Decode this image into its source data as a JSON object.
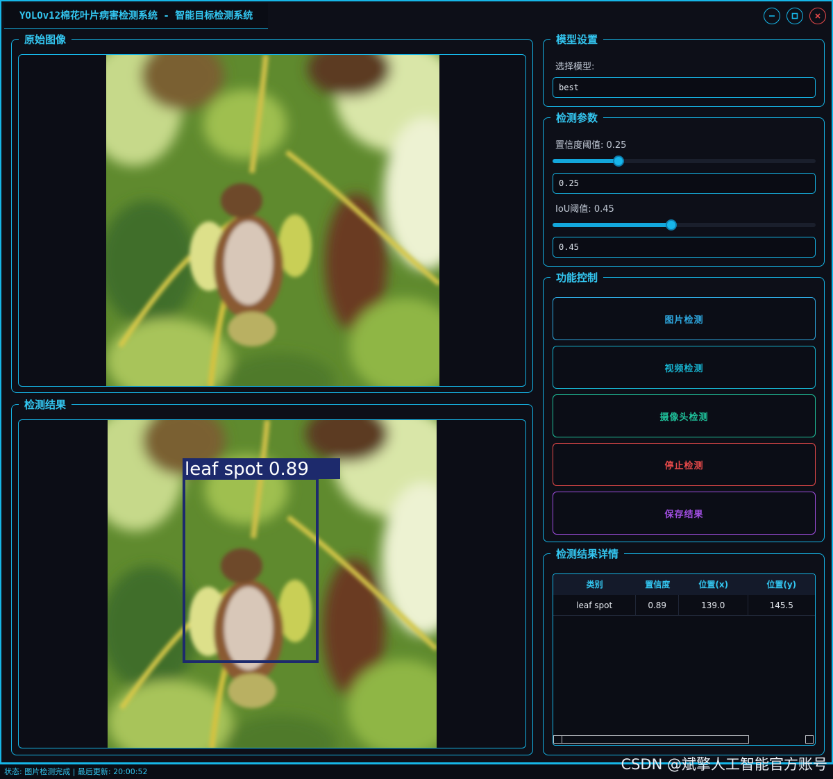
{
  "window": {
    "title": "YOLOv12棉花叶片病害检测系统 - 智能目标检测系统"
  },
  "panels": {
    "original_title": "原始图像",
    "result_title": "检测结果",
    "detection": {
      "label": "leaf spot 0.89",
      "box_color": "#1d2a6c"
    }
  },
  "model_settings": {
    "title": "模型设置",
    "select_label": "选择模型:",
    "selected_model": "best"
  },
  "params": {
    "title": "检测参数",
    "confidence_label": "置信度阈值: 0.25",
    "confidence_value": "0.25",
    "confidence_fraction": 0.25,
    "iou_label": "IoU阈值: 0.45",
    "iou_value": "0.45",
    "iou_fraction": 0.45
  },
  "controls": {
    "title": "功能控制",
    "buttons": [
      {
        "label": "图片检测",
        "color": "#2ea8e0"
      },
      {
        "label": "视频检测",
        "color": "#17b3cf"
      },
      {
        "label": "摄像头检测",
        "color": "#1fc09a"
      },
      {
        "label": "停止检测",
        "color": "#e84a4a"
      },
      {
        "label": "保存结果",
        "color": "#a04ee0"
      }
    ]
  },
  "details": {
    "title": "检测结果详情",
    "columns": [
      "类别",
      "置信度",
      "位置(x)",
      "位置(y)"
    ],
    "rows": [
      [
        "leaf spot",
        "0.89",
        "139.0",
        "145.5"
      ]
    ]
  },
  "status": {
    "text": "状态: 图片检测完成 | 最后更新: 20:00:52"
  },
  "watermark": "CSDN @斌擎人工智能官方账号",
  "colors": {
    "accent": "#16b6e8",
    "background": "#0d0f18"
  }
}
